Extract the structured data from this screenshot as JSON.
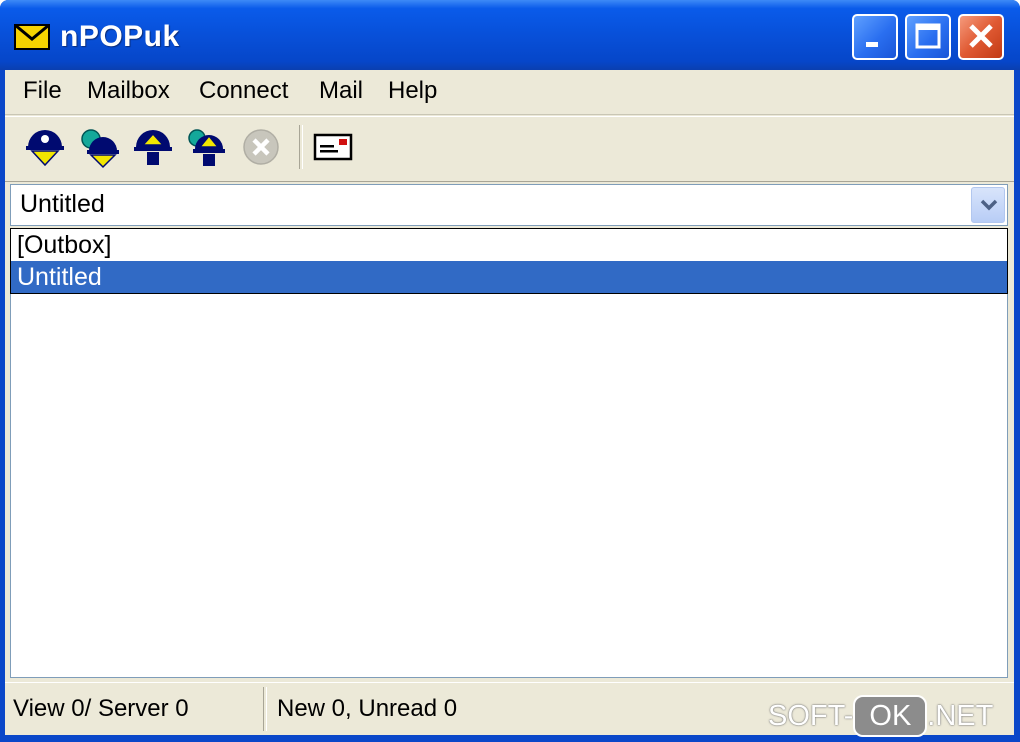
{
  "window": {
    "title": "nPOPuk"
  },
  "menu": {
    "items": [
      {
        "label": "File"
      },
      {
        "label": "Mailbox"
      },
      {
        "label": "Connect"
      },
      {
        "label": "Mail"
      },
      {
        "label": "Help"
      }
    ]
  },
  "toolbar": {
    "buttons": [
      {
        "icon": "check-new-mail-icon"
      },
      {
        "icon": "check-all-mailboxes-icon"
      },
      {
        "icon": "execute-icon"
      },
      {
        "icon": "execute-all-icon"
      },
      {
        "icon": "stop-icon"
      },
      {
        "icon": "new-message-icon"
      }
    ]
  },
  "mailbox_select": {
    "value": "Untitled",
    "options": [
      "[Outbox]",
      "Untitled"
    ],
    "selected_index": 1
  },
  "status": {
    "left": "View 0/ Server 0",
    "right": "New 0, Unread 0"
  },
  "watermark": {
    "prefix": "SOFT-",
    "pill": "OK",
    "suffix": ".NET"
  },
  "colors": {
    "titlebar": "#0850d9",
    "selection": "#316ac5",
    "face": "#ece9d8",
    "close": "#e05a33"
  }
}
